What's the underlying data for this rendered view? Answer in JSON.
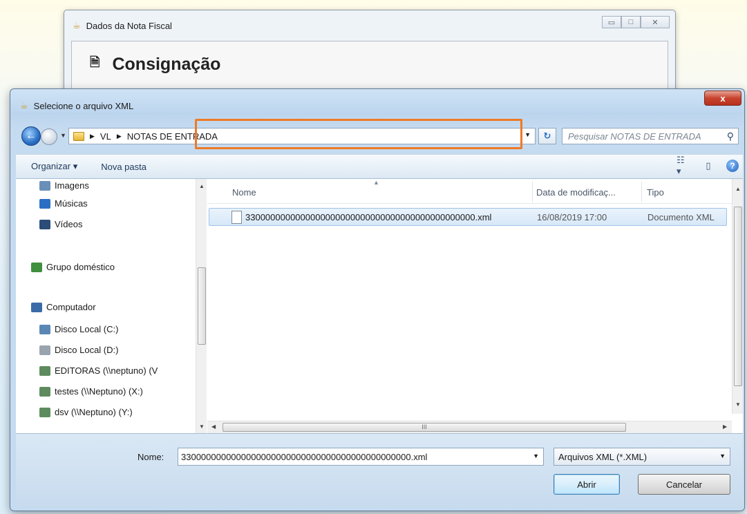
{
  "back_window": {
    "title": "Dados da Nota Fiscal",
    "heading": "Consignação"
  },
  "dialog": {
    "title": "Selecione o arquivo XML",
    "close_label": "x",
    "breadcrumb": [
      "VL",
      "NOTAS DE ENTRADA"
    ],
    "search_placeholder": "Pesquisar NOTAS DE ENTRADA"
  },
  "toolbar": {
    "organize_label": "Organizar ▾",
    "new_folder_label": "Nova pasta"
  },
  "nav_pane": {
    "items": [
      {
        "label": "Imagens",
        "icon": "images-icon",
        "color": "#6a8fb8"
      },
      {
        "label": "Músicas",
        "icon": "music-icon",
        "color": "#2a6fc4"
      },
      {
        "label": "Vídeos",
        "icon": "videos-icon",
        "color": "#2b4d78"
      },
      {
        "label": "Grupo doméstico",
        "icon": "homegroup-icon",
        "color": "#3f8f3f"
      },
      {
        "label": "Computador",
        "icon": "computer-icon",
        "color": "#3a6aa8"
      },
      {
        "label": "Disco Local (C:)",
        "icon": "drive-c-icon",
        "color": "#5b87b5"
      },
      {
        "label": "Disco Local (D:)",
        "icon": "drive-icon",
        "color": "#9aa4ae"
      },
      {
        "label": "EDITORAS (\\\\neptuno) (V",
        "icon": "network-drive-icon",
        "color": "#5e8b5e"
      },
      {
        "label": "testes (\\\\Neptuno) (X:)",
        "icon": "network-drive-icon",
        "color": "#5e8b5e"
      },
      {
        "label": "dsv (\\\\Neptuno) (Y:)",
        "icon": "network-drive-icon",
        "color": "#5e8b5e"
      }
    ]
  },
  "file_list": {
    "columns": [
      "Nome",
      "Data de modificaç...",
      "Tipo"
    ],
    "rows": [
      {
        "name": "3300000000000000000000000000000000000000000000.xml",
        "date": "16/08/2019 17:00",
        "type": "Documento XML"
      }
    ]
  },
  "bottom": {
    "name_label": "Nome:",
    "name_value": "3300000000000000000000000000000000000000000000.xml",
    "filter_value": "Arquivos XML (*.XML)",
    "open_label": "Abrir",
    "cancel_label": "Cancelar"
  },
  "colors": {
    "highlight": "#ee7a26",
    "title_close": "#c8442f"
  }
}
